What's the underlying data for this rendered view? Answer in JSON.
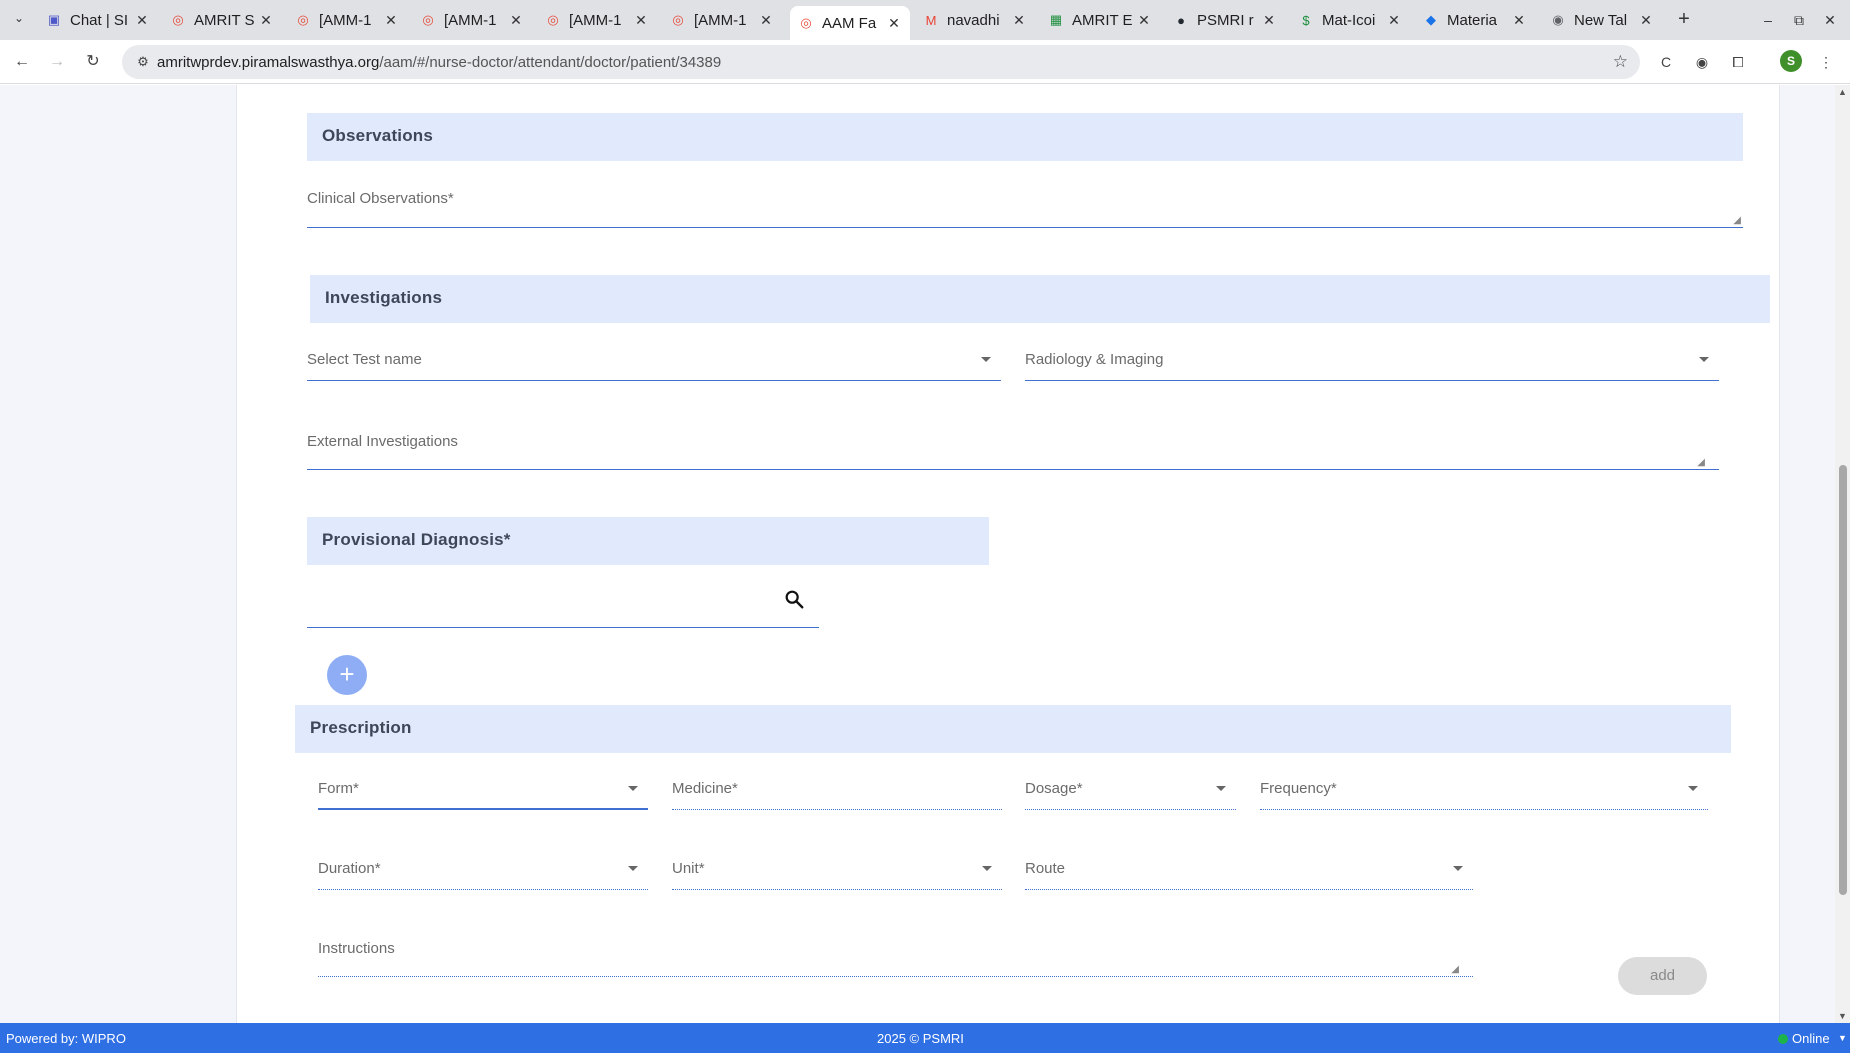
{
  "browser": {
    "tabs": [
      {
        "title": "Chat | SI",
        "icon": "teams-icon",
        "color": "#5059c9"
      },
      {
        "title": "AMRIT S",
        "icon": "amrit-icon",
        "color": "#e74c3c"
      },
      {
        "title": "[AMM-1",
        "icon": "amrit-icon",
        "color": "#e74c3c"
      },
      {
        "title": "[AMM-1",
        "icon": "amrit-icon",
        "color": "#e74c3c"
      },
      {
        "title": "[AMM-1",
        "icon": "amrit-icon",
        "color": "#e74c3c"
      },
      {
        "title": "[AMM-1",
        "icon": "amrit-icon",
        "color": "#e74c3c"
      },
      {
        "title": "AAM Fa",
        "icon": "amrit-icon",
        "color": "#e74c3c"
      },
      {
        "title": "navadhi",
        "icon": "gmail-icon",
        "color": "#ea4335"
      },
      {
        "title": "AMRIT E",
        "icon": "sheets-icon",
        "color": "#1e8e3e"
      },
      {
        "title": "PSMRI r",
        "icon": "github-icon",
        "color": "#24292f"
      },
      {
        "title": "Mat-Icoi",
        "icon": "sheets-dollar-icon",
        "color": "#1e8e3e"
      },
      {
        "title": "Materia",
        "icon": "material-icon",
        "color": "#1a73e8"
      },
      {
        "title": "New Tal",
        "icon": "chrome-icon",
        "color": "#5f6368"
      }
    ],
    "url_host": "amritwprdev.piramalswasthya.org",
    "url_path": "/aam/#/nurse-doctor/attendant/doctor/patient/34389",
    "profile_initial": "S"
  },
  "observations": {
    "title": "Observations",
    "clinical_label": "Clinical Observations",
    "required_mark": "*"
  },
  "investigations": {
    "title": "Investigations",
    "test_name_placeholder": "Select Test name",
    "radiology_placeholder": "Radiology & Imaging",
    "external_label": "External Investigations"
  },
  "diagnosis": {
    "title": "Provisional Diagnosis*",
    "add_symbol": "+"
  },
  "prescription": {
    "title": "Prescription",
    "form": "Form",
    "medicine": "Medicine",
    "dosage": "Dosage",
    "frequency": "Frequency",
    "duration": "Duration",
    "unit": "Unit",
    "route": "Route",
    "instructions": "Instructions",
    "add_label": "add",
    "req": "*"
  },
  "footer": {
    "powered_by": "Powered by: WIPRO",
    "copyright": "2025 © PSMRI",
    "status": "Online"
  }
}
